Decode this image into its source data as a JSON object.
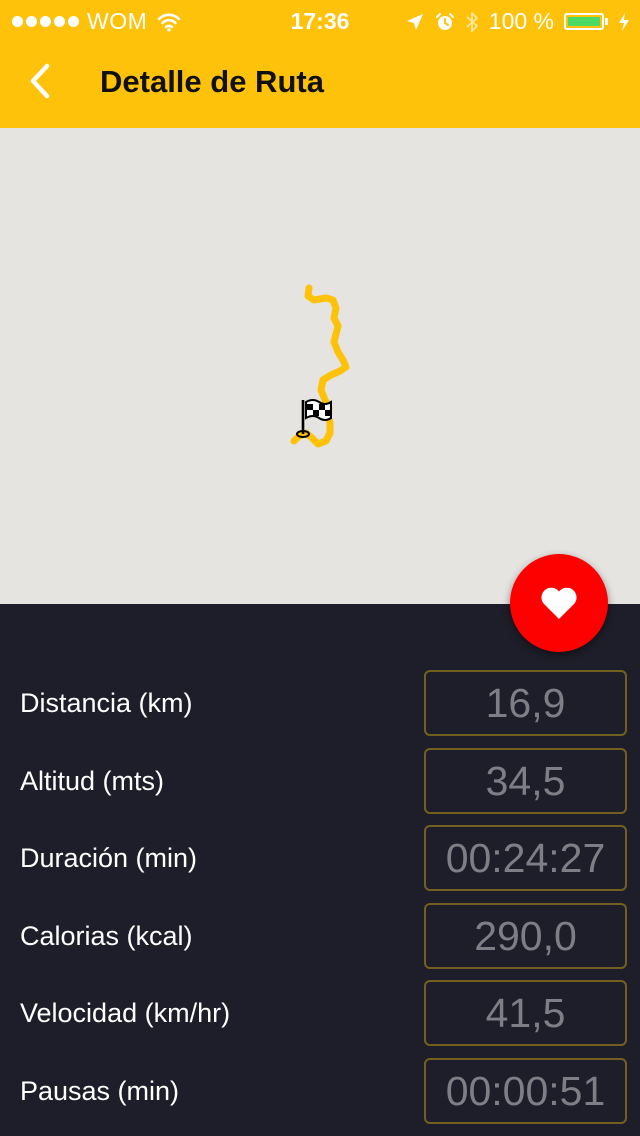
{
  "status_bar": {
    "carrier": "WOM",
    "time": "17:36",
    "battery": "100 %"
  },
  "nav": {
    "title": "Detalle de Ruta",
    "back_icon": "chevron-left-icon"
  },
  "map": {
    "route_color": "#fec20b",
    "marker_icon": "checkered-flag-icon"
  },
  "favorite": {
    "icon": "heart-icon",
    "color": "#fd0000"
  },
  "stats": [
    {
      "label": "Distancia (km)",
      "value": "16,9"
    },
    {
      "label": "Altitud (mts)",
      "value": "34,5"
    },
    {
      "label": "Duración (min)",
      "value": "00:24:27"
    },
    {
      "label": "Calorias (kcal)",
      "value": "290,0"
    },
    {
      "label": "Velocidad (km/hr)",
      "value": "41,5"
    },
    {
      "label": "Pausas (min)",
      "value": "00:00:51"
    }
  ],
  "colors": {
    "header": "#fec20b",
    "panel": "#1e1e2a",
    "map_background": "#e6e4e0",
    "value_border": "#73601e",
    "value_text": "#7e7e86"
  }
}
